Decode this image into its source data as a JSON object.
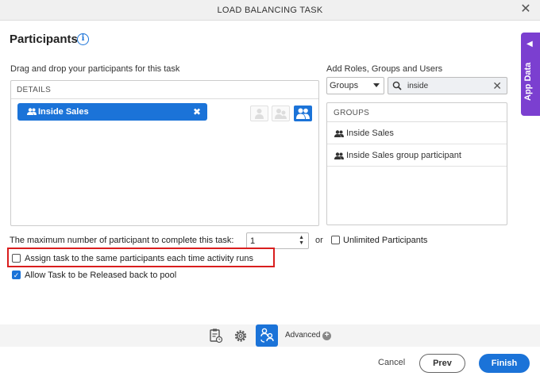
{
  "dialog": {
    "title": "LOAD BALANCING TASK",
    "close_icon": "close-icon"
  },
  "header": {
    "title": "Participants",
    "info_icon": "info-icon"
  },
  "app_data_tab": {
    "label": "App Data",
    "icon": "chevron-left-icon",
    "color": "#7b3fd0"
  },
  "participants": {
    "instruction": "Drag and drop your participants for this task",
    "details_header": "DETAILS",
    "selected": [
      {
        "label": "Inside Sales",
        "icon": "group-icon"
      }
    ],
    "type_buttons": [
      {
        "name": "single-user-icon",
        "active": false
      },
      {
        "name": "multi-user-icon",
        "active": false
      },
      {
        "name": "group-icon",
        "active": true
      }
    ]
  },
  "add_panel": {
    "label": "Add Roles, Groups and Users",
    "filter_select": "Groups",
    "search_value": "inside",
    "list_header": "GROUPS",
    "items": [
      {
        "label": "Inside Sales",
        "icon": "group-icon"
      },
      {
        "label": "Inside Sales group participant",
        "icon": "group-icon"
      }
    ]
  },
  "options": {
    "max_label": "The maximum number of participant to complete this task:",
    "max_value": "1",
    "or_label": "or",
    "unlimited_label": "Unlimited Participants",
    "unlimited_checked": false,
    "same_participants_label": "Assign task to the same participants each time activity runs",
    "same_participants_checked": false,
    "release_label": "Allow Task to be Released back to pool",
    "release_checked": true
  },
  "toolbar": {
    "icons": [
      "task-clipboard-icon",
      "settings-gear-icon",
      "participants-flow-icon"
    ],
    "advanced_label": "Advanced"
  },
  "footer": {
    "cancel": "Cancel",
    "prev": "Prev",
    "finish": "Finish"
  },
  "colors": {
    "accent": "#1b73d8",
    "highlight": "#d91e1e"
  }
}
